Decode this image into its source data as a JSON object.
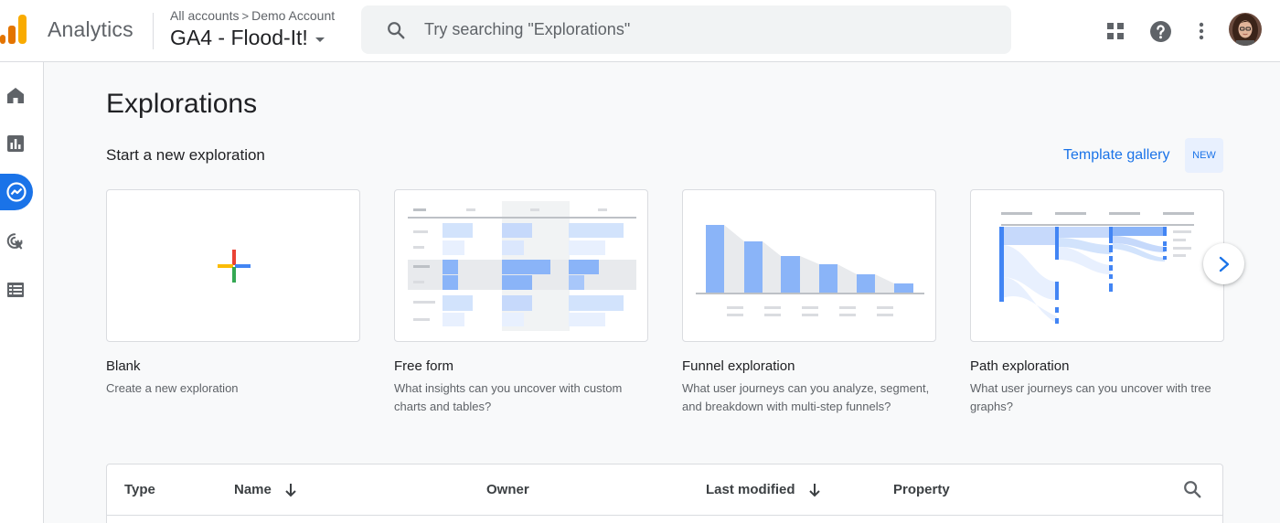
{
  "header": {
    "product_name": "Analytics",
    "breadcrumb": [
      "All accounts",
      "Demo Account"
    ],
    "breadcrumb_separator": ">",
    "property_name": "GA4 - Flood-It!",
    "search_placeholder": "Try searching \"Explorations\""
  },
  "icons": {
    "apps": "apps-grid-icon",
    "help": "help-icon",
    "more": "more-vert-icon"
  },
  "nav": [
    {
      "name": "home-icon",
      "active": false
    },
    {
      "name": "reports-icon",
      "active": false
    },
    {
      "name": "explore-icon",
      "active": true
    },
    {
      "name": "advertising-icon",
      "active": false
    },
    {
      "name": "configure-icon",
      "active": false
    }
  ],
  "main": {
    "title": "Explorations",
    "section_title": "Start a new exploration",
    "template_gallery": "Template gallery",
    "new_badge": "NEW"
  },
  "cards": [
    {
      "title": "Blank",
      "desc": "Create a new exploration"
    },
    {
      "title": "Free form",
      "desc": "What insights can you uncover with custom charts and tables?"
    },
    {
      "title": "Funnel exploration",
      "desc": "What user journeys can you analyze, segment, and breakdown with multi-step funnels?"
    },
    {
      "title": "Path exploration",
      "desc": "What user journeys can you uncover with tree graphs?"
    }
  ],
  "table": {
    "columns": [
      "Type",
      "Name",
      "Owner",
      "Last modified",
      "Property"
    ]
  },
  "colors": {
    "accent": "#1a73e8",
    "illustration_blue": "#8ab4f8",
    "illustration_light": "#d2e3fc"
  }
}
